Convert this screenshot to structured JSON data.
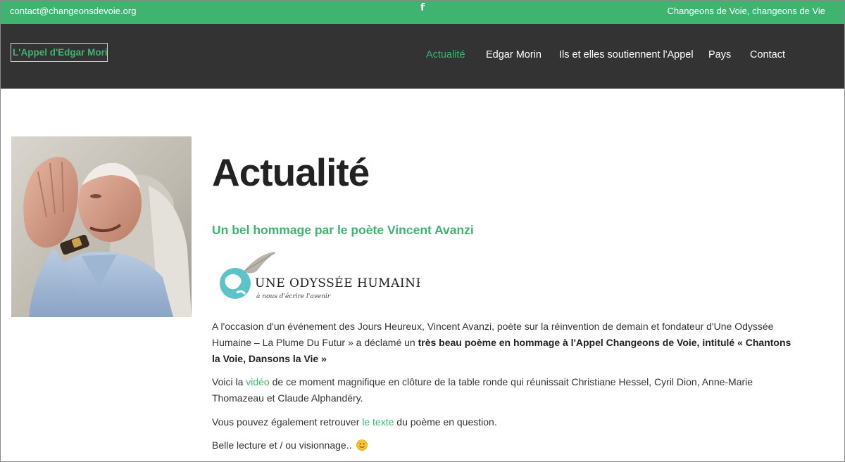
{
  "topbar": {
    "email": "contact@changeonsdevoie.org",
    "facebook_glyph": "f",
    "tagline": "Changeons de Voie, changeons de Vie"
  },
  "header": {
    "logo": "L'Appel d'Edgar Morin",
    "nav": [
      {
        "label": "Actualité",
        "active": true
      },
      {
        "label": "Edgar Morin",
        "active": false
      },
      {
        "label": "Ils et elles soutiennent l'Appel",
        "active": false
      },
      {
        "label": "Pays",
        "active": false
      },
      {
        "label": "Contact",
        "active": false
      }
    ]
  },
  "main": {
    "title": "Actualité",
    "subtitle": "Un bel hommage par le poète Vincent Avanzi",
    "odyssey_logo": {
      "title": "UNE ODYSSÉE HUMAINE",
      "tagline": "à nous d'écrire l'avenir"
    },
    "paragraphs": {
      "p1_text": "A l'occasion d'un événement des Jours Heureux, Vincent Avanzi, poète sur la réinvention de demain et fondateur d'Une Odyssée Humaine – La Plume Du Futur » a déclamé un ",
      "p1_bold": "très beau poème en hommage à l'Appel Changeons de Voie, intitulé « Chantons la Voie, Dansons la Vie »",
      "p2_before": "Voici la ",
      "p2_link": "vidéo",
      "p2_after": " de ce moment magnifique en clôture de la table ronde qui réunissait Christiane Hessel, Cyril Dion, Anne-Marie Thomazeau et Claude Alphandéry.",
      "p3_before": "Vous pouvez également retrouver ",
      "p3_link": "le texte",
      "p3_after": " du poème en question.",
      "p4_text": "Belle lecture et / ou visionnage.."
    }
  },
  "colors": {
    "accent": "#3fb470",
    "header_bg": "#333333",
    "text": "#333333"
  },
  "icons": {
    "facebook": "facebook-icon",
    "smiley": "smiley-icon",
    "feather": "feather-icon"
  }
}
